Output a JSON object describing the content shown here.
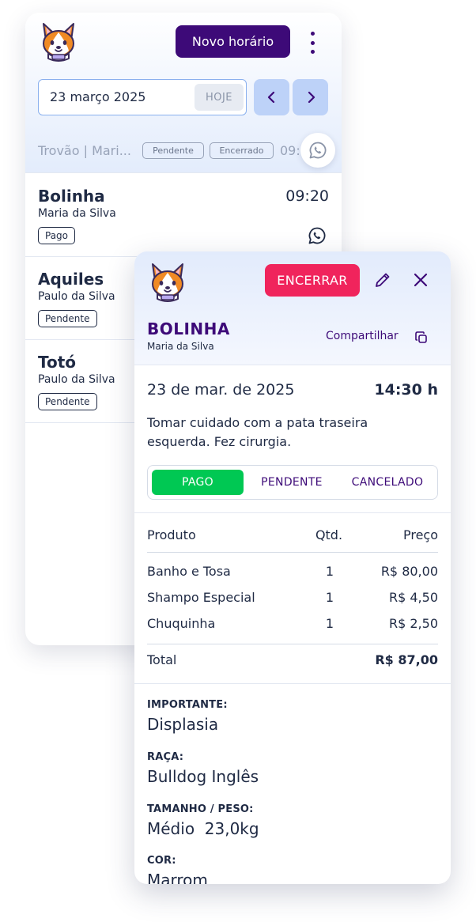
{
  "agenda": {
    "new_button": "Novo horário",
    "date": "23 março 2025",
    "today_button": "HOJE",
    "filter": {
      "search_text": "Trovão | Mari...",
      "tag_pendente": "Pendente",
      "tag_encerrado": "Encerrado",
      "time": "09:"
    },
    "appointments": [
      {
        "pet": "Bolinha",
        "owner": "Maria da Silva",
        "status": "Pago",
        "time": "09:20"
      },
      {
        "pet": "Aquiles",
        "owner": "Paulo da Silva",
        "status": "Pendente"
      },
      {
        "pet": "Totó",
        "owner": "Paulo da Silva",
        "status": "Pendente"
      }
    ]
  },
  "detail": {
    "close_appointment_button": "ENCERRAR",
    "pet_name": "BOLINHA",
    "owner": "Maria da Silva",
    "share_label": "Compartilhar",
    "date": "23 de mar. de 2025",
    "time": "14:30 h",
    "note": "Tomar cuidado com a pata traseira esquerda. Fez cirurgia.",
    "status_options": [
      "PAGO",
      "PENDENTE",
      "CANCELADO"
    ],
    "selected_status": "PAGO",
    "table": {
      "headers": [
        "Produto",
        "Qtd.",
        "Preço"
      ],
      "rows": [
        [
          "Banho e Tosa",
          "1",
          "R$ 80,00"
        ],
        [
          "Shampo Especial",
          "1",
          "R$ 4,50"
        ],
        [
          "Chuquinha",
          "1",
          "R$ 2,50"
        ]
      ],
      "total_label": "Total",
      "total_value": "R$ 87,00"
    },
    "info": [
      {
        "label": "IMPORTANTE:",
        "value": "Displasia"
      },
      {
        "label": "RAÇA:",
        "value": "Bulldog Inglês"
      },
      {
        "label": "TAMANHO / PESO:",
        "value": "Médio  23,0kg"
      },
      {
        "label": "COR:",
        "value": "Marrom"
      }
    ]
  },
  "colors": {
    "brand_purple": "#3d0a78",
    "danger_pink": "#f0245c",
    "success_green": "#00c853",
    "nav_blue": "#bdd2f8"
  },
  "icons": [
    "corgi-logo-icon",
    "kebab-menu-icon",
    "chevron-left-icon",
    "chevron-right-icon",
    "whatsapp-icon",
    "pencil-icon",
    "close-icon",
    "copy-icon"
  ]
}
